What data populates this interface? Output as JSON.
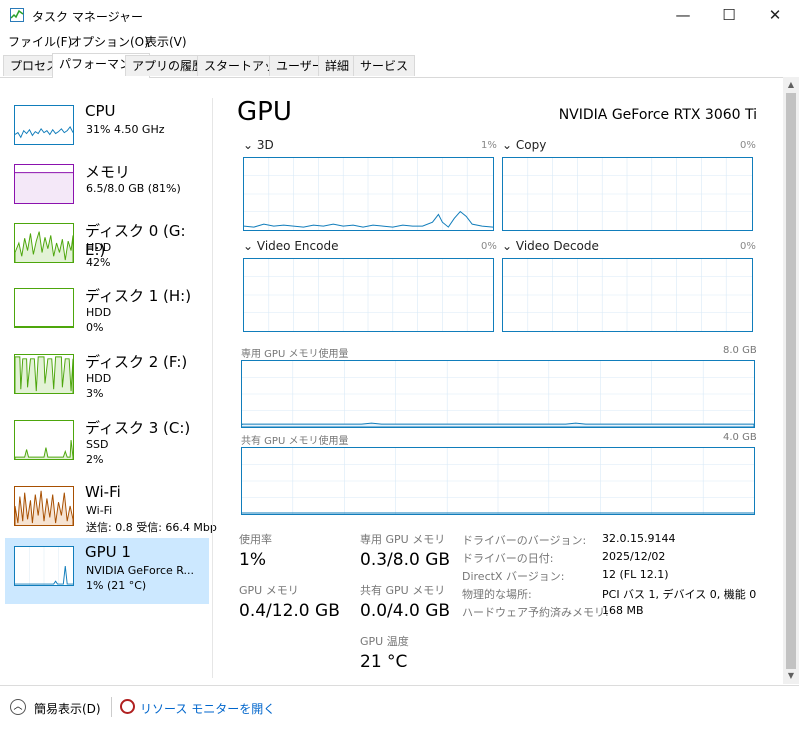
{
  "window": {
    "title": "タスク マネージャー",
    "minimize": "—",
    "maximize": "☐",
    "close": "✕"
  },
  "menu": [
    "ファイル(F)",
    "オプション(O)",
    "表示(V)"
  ],
  "tabs": [
    "プロセス",
    "パフォーマンス",
    "アプリの履歴",
    "スタートアップ",
    "ユーザー",
    "詳細",
    "サービス"
  ],
  "sidebar": [
    {
      "title": "CPU",
      "sub1": "31%  4.50 GHz",
      "sub2": "",
      "sub3": "",
      "color": "#117dbb"
    },
    {
      "title": "メモリ",
      "sub1": "6.5/8.0 GB (81%)",
      "sub2": "",
      "sub3": "",
      "color": "#8b12ae"
    },
    {
      "title": "ディスク 0 (G: E:)",
      "sub1": "HDD",
      "sub2": "42%",
      "sub3": "",
      "color": "#4da60c"
    },
    {
      "title": "ディスク 1 (H:)",
      "sub1": "HDD",
      "sub2": "0%",
      "sub3": "",
      "color": "#4da60c"
    },
    {
      "title": "ディスク 2 (F:)",
      "sub1": "HDD",
      "sub2": "3%",
      "sub3": "",
      "color": "#4da60c"
    },
    {
      "title": "ディスク 3 (C:)",
      "sub1": "SSD",
      "sub2": "2%",
      "sub3": "",
      "color": "#4da60c"
    },
    {
      "title": "Wi-Fi",
      "sub1": "Wi-Fi",
      "sub2": "送信: 0.8  受信: 66.4 Mbp",
      "sub3": "",
      "color": "#a74f01"
    },
    {
      "title": "GPU 1",
      "sub1": "NVIDIA GeForce R...",
      "sub2": "1% (21 °C)",
      "sub3": "",
      "color": "#117dbb"
    }
  ],
  "gpu": {
    "title": "GPU",
    "model": "NVIDIA GeForce RTX 3060 Ti",
    "engines": [
      {
        "name": "3D",
        "pct": "1%"
      },
      {
        "name": "Copy",
        "pct": "0%"
      },
      {
        "name": "Video Encode",
        "pct": "0%"
      },
      {
        "name": "Video Decode",
        "pct": "0%"
      }
    ],
    "dedicated_label": "専用 GPU メモリ使用量",
    "dedicated_max": "8.0 GB",
    "shared_label": "共有 GPU メモリ使用量",
    "shared_max": "4.0 GB"
  },
  "stats": {
    "usage_label": "使用率",
    "usage_val": "1%",
    "gpumem_label": "GPU メモリ",
    "gpumem_val": "0.4/12.0 GB",
    "dedmem_label": "専用 GPU メモリ",
    "dedmem_val": "0.3/8.0 GB",
    "shmem_label": "共有 GPU メモリ",
    "shmem_val": "0.0/4.0 GB",
    "temp_label": "GPU 温度",
    "temp_val": "21 °C"
  },
  "details": [
    {
      "label": "ドライバーのバージョン:",
      "value": "32.0.15.9144"
    },
    {
      "label": "ドライバーの日付:",
      "value": "2025/12/02"
    },
    {
      "label": "DirectX バージョン:",
      "value": "12 (FL 12.1)"
    },
    {
      "label": "物理的な場所:",
      "value": "PCI バス 1, デバイス 0, 機能 0"
    },
    {
      "label": "ハードウェア予約済みメモリ:",
      "value": "168 MB"
    }
  ],
  "bottom": {
    "fewer_details": "簡易表示(D)",
    "open_resmon": "リソース モニターを開く"
  }
}
